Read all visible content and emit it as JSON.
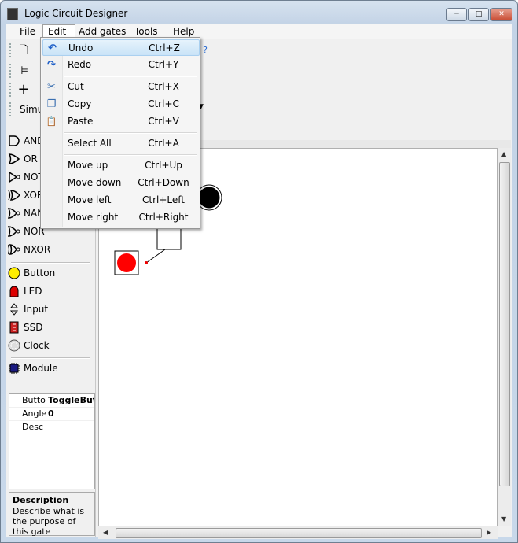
{
  "window": {
    "title": "Logic Circuit Designer",
    "min": "─",
    "max": "□",
    "close": "✕"
  },
  "menubar": [
    "File",
    "Edit",
    "Add gates",
    "Tools",
    "Help"
  ],
  "toolbar": {
    "sim_label": "Simu"
  },
  "edit_menu": [
    {
      "label": "Undo",
      "shortcut": "Ctrl+Z",
      "icon": "undo-icon",
      "glyph": "↶"
    },
    {
      "label": "Redo",
      "shortcut": "Ctrl+Y",
      "icon": "redo-icon",
      "glyph": "↷"
    },
    {
      "label": "Cut",
      "shortcut": "Ctrl+X",
      "icon": "scissors-icon",
      "glyph": "✂"
    },
    {
      "label": "Copy",
      "shortcut": "Ctrl+C",
      "icon": "copy-icon",
      "glyph": "❐"
    },
    {
      "label": "Paste",
      "shortcut": "Ctrl+V",
      "icon": "paste-icon",
      "glyph": "📋"
    },
    {
      "label": "Select All",
      "shortcut": "Ctrl+A"
    },
    {
      "label": "Move up",
      "shortcut": "Ctrl+Up"
    },
    {
      "label": "Move down",
      "shortcut": "Ctrl+Down"
    },
    {
      "label": "Move left",
      "shortcut": "Ctrl+Left"
    },
    {
      "label": "Move right",
      "shortcut": "Ctrl+Right"
    }
  ],
  "gates": [
    "AND",
    "OR",
    "NOT",
    "XOR",
    "NAND",
    "NOR",
    "NXOR"
  ],
  "io": [
    "Button",
    "LED",
    "Input",
    "SSD",
    "Clock"
  ],
  "module": "Module",
  "properties": [
    {
      "name": "Butto",
      "value": "ToggleBut"
    },
    {
      "name": "Angle",
      "value": "0"
    },
    {
      "name": "Desc",
      "value": ""
    }
  ],
  "description": {
    "title": "Description",
    "text": "Describe what is the purpose of this gate"
  },
  "colors": {
    "led_off": "#000000",
    "button_on": "#ff0000",
    "button_icon": "#ffee00",
    "led_icon": "#dd0000"
  }
}
